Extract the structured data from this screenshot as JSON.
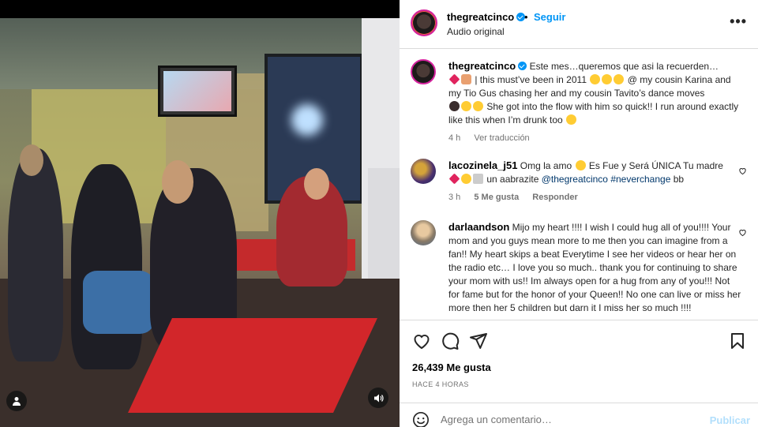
{
  "post_header": {
    "username": "thegreatcinco",
    "follow_label": "Seguir",
    "audio_label": "Audio original",
    "separator": "•"
  },
  "caption": {
    "username": "thegreatcinco",
    "text_1": "Este mes…queremos que asi la recuerden…",
    "text_2": "| this must’ve been in 2011",
    "text_3": "@ my cousin Karina and my Tio Gus chasing her and my cousin Tavito’s dance moves",
    "text_4": "She got into the flow with him so quick!! I run around exactly like this when I’m drunk too",
    "time": "4 h",
    "translate_label": "Ver traducción"
  },
  "comments": [
    {
      "username": "lacozinela_j51",
      "text_a": "Omg la amo",
      "text_b": "Es Fue y Será ÚNICA Tu madre",
      "text_c": "un aabrazite",
      "mention": "@thegreatcinco",
      "hashtag": "#neverchange",
      "text_d": "bb",
      "time": "3 h",
      "likes": "5 Me gusta",
      "reply_label": "Responder"
    },
    {
      "username": "darlaandson",
      "text": "Mijo my heart !!!! I wish I could hug all of you!!!! Your mom and you guys mean more to me then you can imagine from a fan!! My heart skips a beat Everytime I see her videos or hear her on the radio etc… I love you so much.. thank you for continuing to share your mom with us!! Im always open for a hug from any of you!!! Not for fame but for the honor of your Queen!! No one can live or miss her more then her 5 children but darn it I miss her so much !!!!"
    }
  ],
  "actions": {
    "like_count": "26,439",
    "like_label": "Me gusta",
    "timestamp": "HACE 4 HORAS"
  },
  "composer": {
    "placeholder": "Agrega un comentario…",
    "publish_label": "Publicar"
  },
  "icons": {
    "header_more": "more-horizontal-icon",
    "like": "heart-icon",
    "comment": "comment-icon",
    "share": "share-icon",
    "save": "bookmark-icon",
    "emoji": "emoji-icon",
    "tagged": "user-tag-icon",
    "mute": "speaker-icon"
  },
  "colors": {
    "accent": "#0095f6",
    "link": "#00376b",
    "muted": "#737373",
    "publish_disabled": "#b2dffc"
  }
}
